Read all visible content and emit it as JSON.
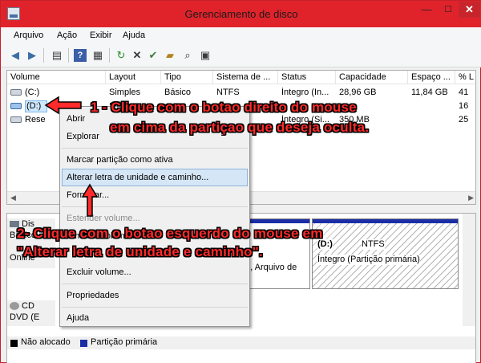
{
  "window": {
    "title": "Gerenciamento de disco",
    "controls": {
      "minimize": "—",
      "maximize": "☐",
      "close": "✕"
    }
  },
  "menu": [
    "Arquivo",
    "Ação",
    "Exibir",
    "Ajuda"
  ],
  "toolbar": {
    "icons": [
      "back-arrow-icon",
      "forward-arrow-icon",
      "console-tree-icon",
      "help-icon",
      "properties-icon",
      "refresh-icon",
      "delete-icon",
      "check-icon",
      "open-folder-icon",
      "search-icon",
      "properties-page-icon"
    ]
  },
  "volume_table": {
    "columns": [
      "Volume",
      "Layout",
      "Tipo",
      "Sistema de ...",
      "Status",
      "Capacidade",
      "Espaço ...",
      "% L"
    ],
    "rows": [
      {
        "volume": "(C:)",
        "layout": "Simples",
        "tipo": "Básico",
        "sistema": "NTFS",
        "status": "Íntegro (In...",
        "capacidade": "28,96 GB",
        "espaco": "11,84 GB",
        "pct": "41"
      },
      {
        "volume": "(D:)",
        "layout": "Si",
        "tipo": "",
        "sistema": "",
        "status": "",
        "capacidade": "",
        "espaco": "",
        "pct": "16"
      },
      {
        "volume": "Rese",
        "layout": "",
        "tipo": "",
        "sistema": "",
        "status": "Íntegro (Si...",
        "capacidade": "350 MB",
        "espaco": "",
        "pct": "25"
      }
    ]
  },
  "disk_view": {
    "disk0": {
      "name": "Dis",
      "type": "Básico",
      "size": "",
      "status": "Online"
    },
    "partition_mid": {
      "line2": "o, Arquivo de"
    },
    "partition_right": {
      "name": "(D:)",
      "fs": "NTFS",
      "status": "Íntegro (Partição primária)"
    },
    "cdrom": {
      "name": "CD",
      "type": "DVD (E"
    },
    "legend": {
      "unallocated": "Não alocado",
      "primary": "Partição primária",
      "colors": {
        "unallocated": "#000000",
        "primary": "#1b2ea6"
      }
    }
  },
  "context_menu": {
    "items": [
      {
        "label": "Abrir",
        "enabled": true
      },
      {
        "label": "Explorar",
        "enabled": true
      },
      {
        "label": "Marcar partição como ativa",
        "enabled": true
      },
      {
        "label": "Alterar letra de unidade e caminho...",
        "enabled": true,
        "highlighted": true
      },
      {
        "label": "Formatar...",
        "enabled": true
      },
      {
        "label": "Estender volume...",
        "enabled": false
      },
      {
        "label": "Diminuir volume...",
        "enabled": true
      },
      {
        "label": "Excluir volume...",
        "enabled": true
      },
      {
        "label": "Propriedades",
        "enabled": true
      },
      {
        "label": "Ajuda",
        "enabled": true
      }
    ]
  },
  "annotations": {
    "step1_line1": "1 - Clique com o botao direito do mouse",
    "step1_line2": "em cima da partiçao que deseja oculta.",
    "step2_line1": "2- Clique com o botao esquerdo do mouse em",
    "step2_line2": "\"Alterar letra de unidade e caminho\".",
    "color": "#ff2a2a"
  }
}
